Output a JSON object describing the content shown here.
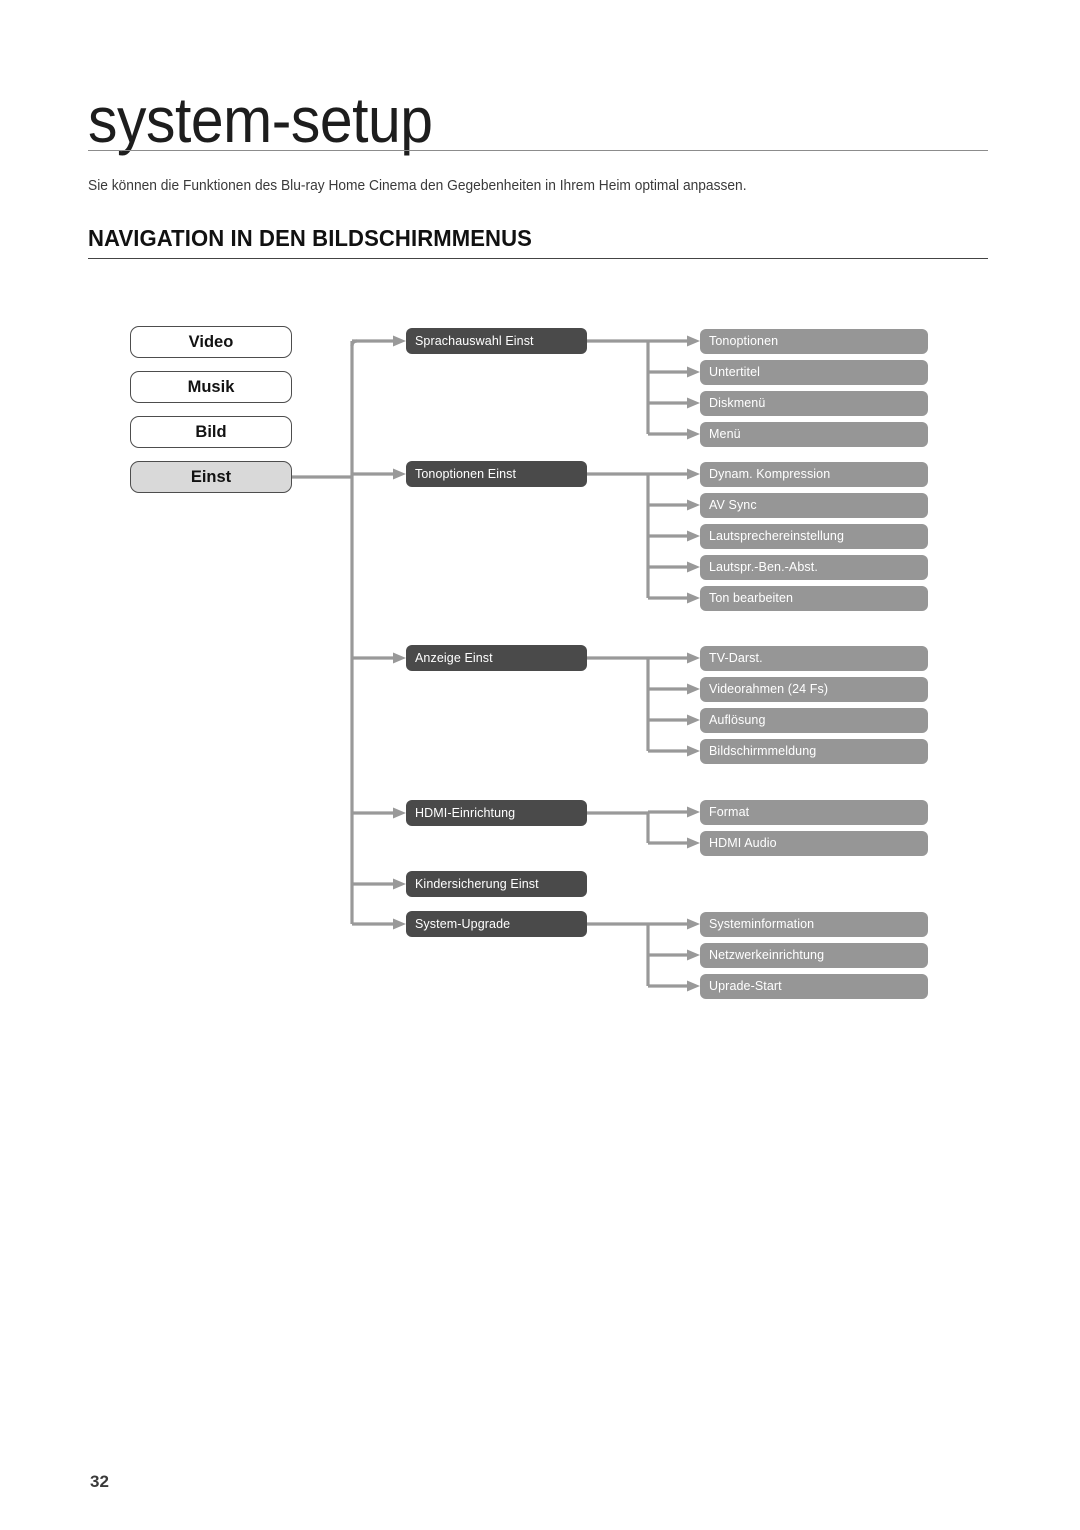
{
  "page": {
    "title": "system-setup",
    "intro": "Sie können die Funktionen des Blu-ray Home Cinema den Gegebenheiten in Ihrem Heim optimal anpassen.",
    "section_heading": "NAVIGATION IN DEN BILDSCHIRMMENUS",
    "page_number": "32"
  },
  "colors": {
    "root_border": "#4d4d4d",
    "root_selected_fill": "#d9d9d9",
    "mid_fill": "#4a4a4a",
    "leaf_fill": "#969696",
    "connector": "#999999",
    "rule": "#444444"
  },
  "diagram": {
    "root_menu": [
      {
        "label": "Video",
        "selected": false
      },
      {
        "label": "Musik",
        "selected": false
      },
      {
        "label": "Bild",
        "selected": false
      },
      {
        "label": "Einst",
        "selected": true
      }
    ],
    "branches": [
      {
        "label": "Sprachauswahl Einst",
        "children": [
          {
            "label": "Tonoptionen"
          },
          {
            "label": "Untertitel"
          },
          {
            "label": "Diskmenü"
          },
          {
            "label": "Menü"
          }
        ]
      },
      {
        "label": "Tonoptionen Einst",
        "children": [
          {
            "label": "Dynam. Kompression"
          },
          {
            "label": "AV Sync"
          },
          {
            "label": "Lautsprechereinstellung"
          },
          {
            "label": "Lautspr.-Ben.-Abst."
          },
          {
            "label": "Ton bearbeiten"
          }
        ]
      },
      {
        "label": "Anzeige Einst",
        "children": [
          {
            "label": "TV-Darst."
          },
          {
            "label": "Videorahmen (24 Fs)"
          },
          {
            "label": "Auflösung"
          },
          {
            "label": "Bildschirmmeldung"
          }
        ]
      },
      {
        "label": "HDMI-Einrichtung",
        "children": [
          {
            "label": "Format"
          },
          {
            "label": "HDMI Audio"
          }
        ]
      },
      {
        "label": "Kindersicherung Einst",
        "children": []
      },
      {
        "label": "System-Upgrade",
        "children": [
          {
            "label": "Systeminformation"
          },
          {
            "label": "Netzwerkeinrichtung"
          },
          {
            "label": "Uprade-Start"
          }
        ]
      }
    ]
  }
}
